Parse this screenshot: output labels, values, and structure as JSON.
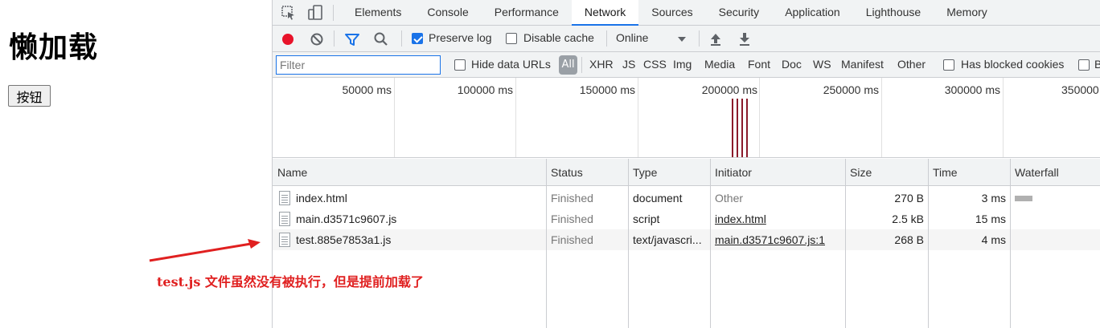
{
  "page": {
    "title": "懒加载",
    "button_label": "按钮"
  },
  "devtools": {
    "tabs": [
      "Elements",
      "Console",
      "Performance",
      "Network",
      "Sources",
      "Security",
      "Application",
      "Lighthouse",
      "Memory"
    ],
    "active_tab": "Network",
    "toolbar": {
      "preserve_log_label": "Preserve log",
      "preserve_log_checked": true,
      "disable_cache_label": "Disable cache",
      "disable_cache_checked": false,
      "throttle_value": "Online"
    },
    "filter": {
      "placeholder": "Filter",
      "hide_data_urls_label": "Hide data URLs",
      "types": [
        "All",
        "XHR",
        "JS",
        "CSS",
        "Img",
        "Media",
        "Font",
        "Doc",
        "WS",
        "Manifest",
        "Other"
      ],
      "active_type": "All",
      "has_blocked_cookies_label": "Has blocked cookies",
      "trailing_label": "B"
    },
    "overview": {
      "ticks": [
        "50000 ms",
        "100000 ms",
        "150000 ms",
        "200000 ms",
        "250000 ms",
        "300000 ms",
        "350000"
      ]
    },
    "grid": {
      "columns": [
        "Name",
        "Status",
        "Type",
        "Initiator",
        "Size",
        "Time",
        "Waterfall"
      ],
      "rows": [
        {
          "name": "index.html",
          "status": "Finished",
          "type": "document",
          "initiator": "Other",
          "size": "270 B",
          "time": "3 ms"
        },
        {
          "name": "main.d3571c9607.js",
          "status": "Finished",
          "type": "script",
          "initiator": "index.html",
          "size": "2.5 kB",
          "time": "15 ms"
        },
        {
          "name": "test.885e7853a1.js",
          "status": "Finished",
          "type": "text/javascri...",
          "initiator": "main.d3571c9607.js:1",
          "size": "268 B",
          "time": "4 ms"
        }
      ]
    }
  },
  "annotation": {
    "text": "test.js 文件虽然没有被执行，但是提前加载了",
    "color": "#e02020"
  }
}
